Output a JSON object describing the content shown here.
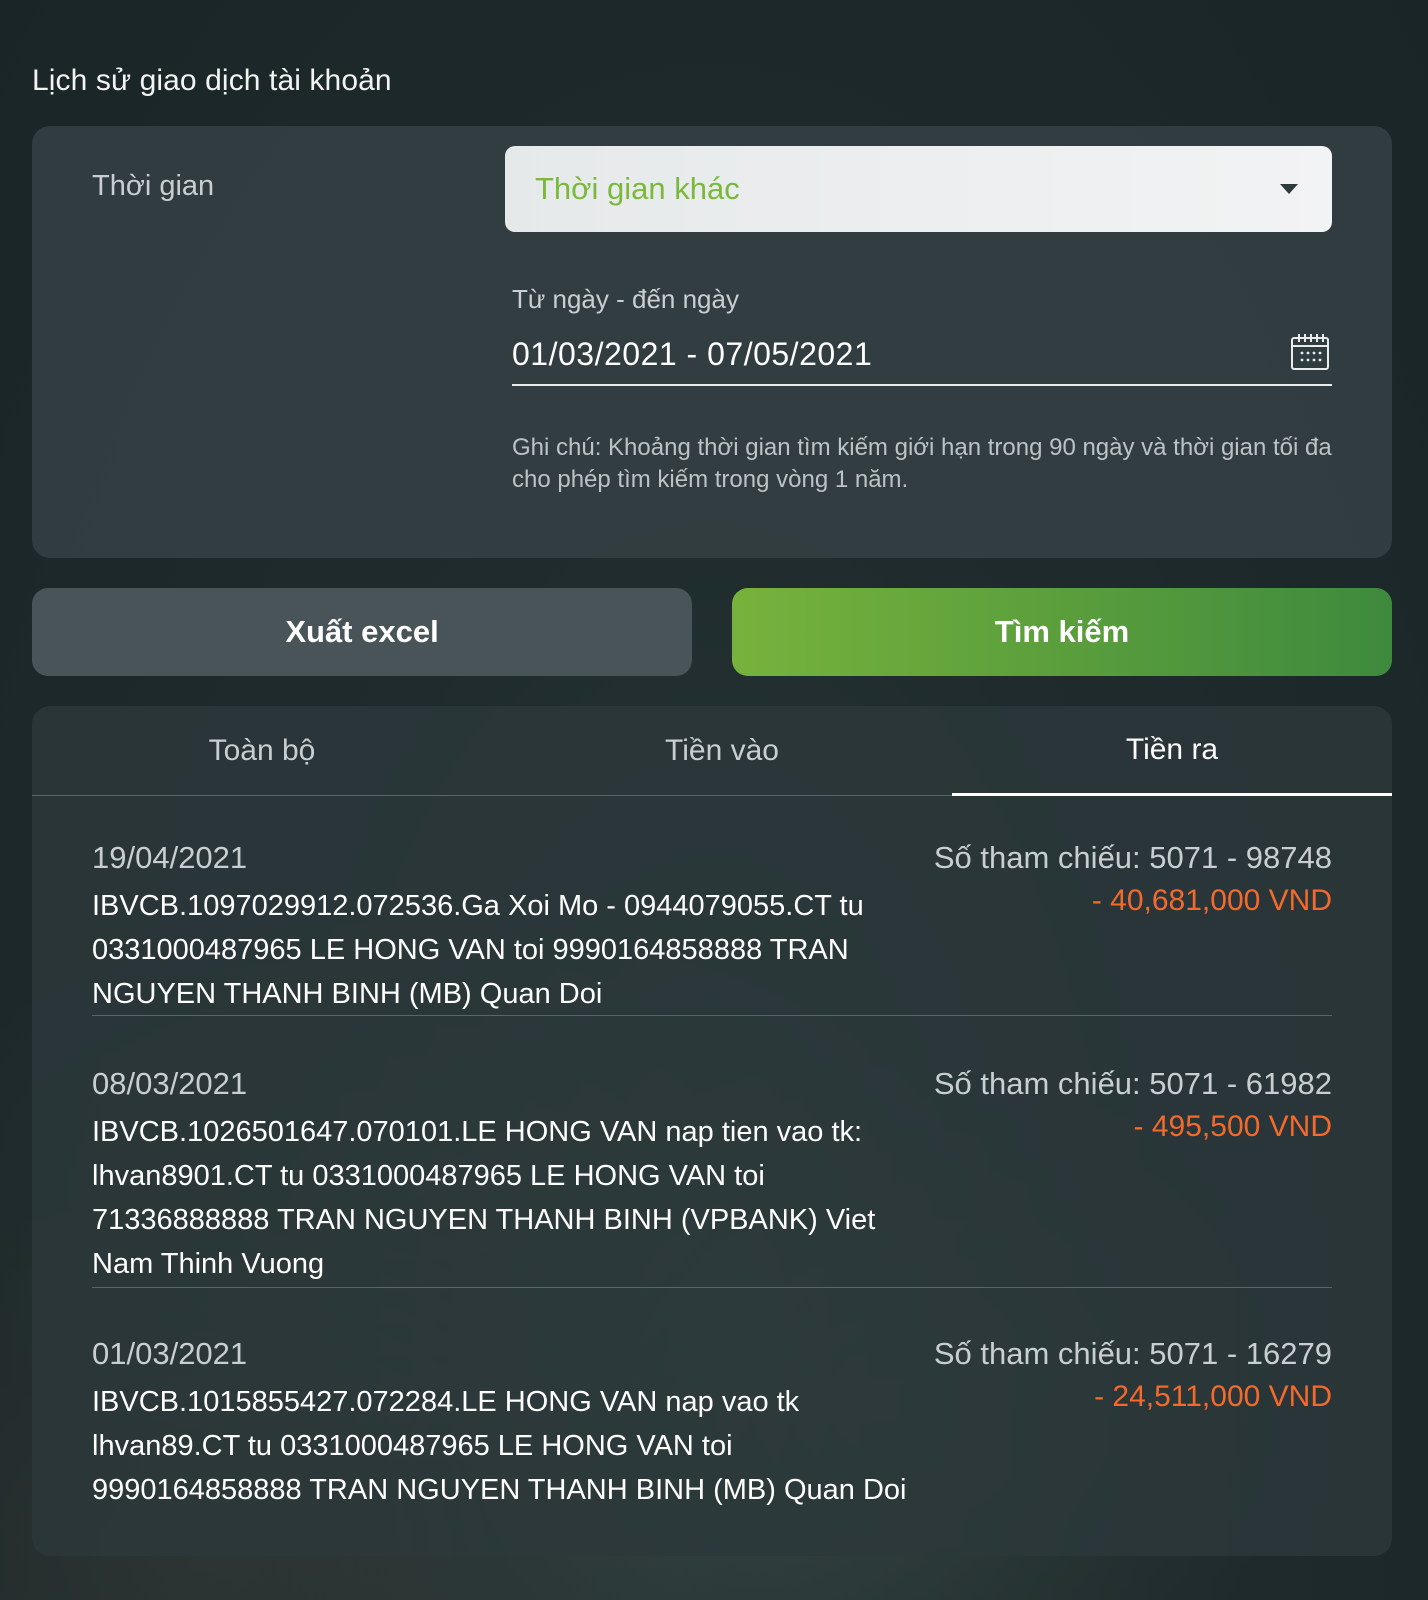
{
  "page": {
    "title": "Lịch sử giao dịch tài khoản"
  },
  "filter": {
    "time_label": "Thời gian",
    "time_select_value": "Thời gian khác",
    "range_label": "Từ ngày - đến ngày",
    "range_value": "01/03/2021 - 07/05/2021",
    "note": "Ghi chú: Khoảng thời gian tìm kiếm giới hạn trong 90 ngày và thời gian tối đa cho phép tìm kiếm trong vòng 1 năm."
  },
  "actions": {
    "export_label": "Xuất excel",
    "search_label": "Tìm kiếm"
  },
  "tabs": [
    {
      "label": "Toàn bộ",
      "active": false
    },
    {
      "label": "Tiền vào",
      "active": false
    },
    {
      "label": "Tiền ra",
      "active": true
    }
  ],
  "transactions": [
    {
      "date": "19/04/2021",
      "description": "IBVCB.1097029912.072536.Ga Xoi Mo - 0944079055.CT tu 0331000487965 LE HONG VAN toi 9990164858888 TRAN NGUYEN THANH BINH (MB) Quan Doi",
      "reference": "Số tham chiếu: 5071 - 98748",
      "amount": "- 40,681,000 VND"
    },
    {
      "date": "08/03/2021",
      "description": "IBVCB.1026501647.070101.LE HONG VAN nap tien vao tk: lhvan8901.CT tu 0331000487965 LE HONG VAN toi 71336888888 TRAN NGUYEN THANH BINH (VPBANK) Viet Nam Thinh Vuong",
      "reference": "Số tham chiếu: 5071 - 61982",
      "amount": "- 495,500 VND"
    },
    {
      "date": "01/03/2021",
      "description": "IBVCB.1015855427.072284.LE HONG VAN nap vao tk lhvan89.CT tu 0331000487965 LE HONG VAN toi 9990164858888 TRAN NGUYEN THANH BINH (MB) Quan Doi",
      "reference": "Số tham chiếu: 5071 - 16279",
      "amount": "- 24,511,000 VND"
    }
  ],
  "colors": {
    "accent_green": "#7ab93a",
    "amount_negative": "#f36a2c"
  }
}
